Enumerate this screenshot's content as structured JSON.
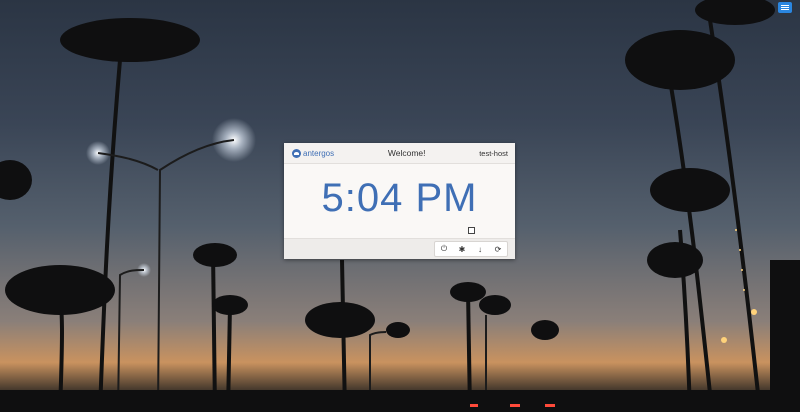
{
  "menu": {
    "icon": "hamburger-menu-icon"
  },
  "greeter": {
    "logo_text": "antergos",
    "welcome": "Welcome!",
    "hostname": "test-host",
    "time": "5:04 PM"
  },
  "actions": [
    {
      "name": "power-icon",
      "glyph": "⏻"
    },
    {
      "name": "suspend-icon",
      "glyph": "✱"
    },
    {
      "name": "hibernate-icon",
      "glyph": "↓"
    },
    {
      "name": "restart-icon",
      "glyph": "⟳"
    }
  ],
  "colors": {
    "accent": "#3f6fb5",
    "menu_button": "#2a86e0"
  }
}
